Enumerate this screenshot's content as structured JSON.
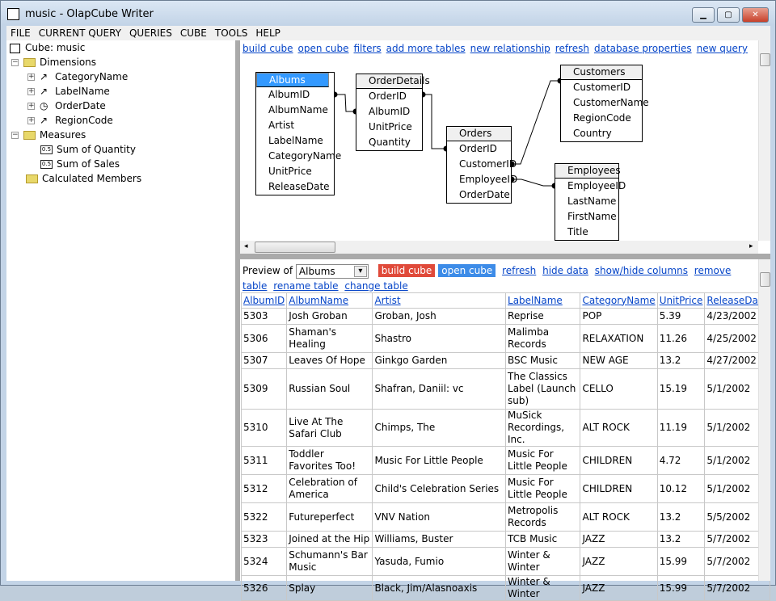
{
  "window": {
    "title": "music - OlapCube Writer",
    "min": "▁",
    "max": "▢",
    "close": "✕"
  },
  "menu": [
    "FILE",
    "CURRENT QUERY",
    "QUERIES",
    "CUBE",
    "TOOLS",
    "HELP"
  ],
  "tree": {
    "cube": "Cube: music",
    "dimensions": "Dimensions",
    "dims": [
      {
        "label": "CategoryName",
        "icon": "hierarchy-icon"
      },
      {
        "label": "LabelName",
        "icon": "hierarchy-icon"
      },
      {
        "label": "OrderDate",
        "icon": "clock-icon"
      },
      {
        "label": "RegionCode",
        "icon": "hierarchy-icon"
      }
    ],
    "measures": "Measures",
    "meas": [
      "Sum of Quantity",
      "Sum of Sales"
    ],
    "calculated": "Calculated Members"
  },
  "diagram_links": [
    "build cube",
    "open cube",
    "filters",
    "add more tables",
    "new relationship",
    "refresh",
    "database properties",
    "new query"
  ],
  "tables": [
    {
      "name": "Albums",
      "selected": true,
      "fields": [
        "AlbumID",
        "AlbumName",
        "Artist",
        "LabelName",
        "CategoryName",
        "UnitPrice",
        "ReleaseDate"
      ]
    },
    {
      "name": "OrderDetails",
      "fields": [
        "OrderID",
        "AlbumID",
        "UnitPrice",
        "Quantity"
      ]
    },
    {
      "name": "Orders",
      "fields": [
        "OrderID",
        "CustomerID",
        "EmployeeID",
        "OrderDate"
      ]
    },
    {
      "name": "Customers",
      "fields": [
        "CustomerID",
        "CustomerName",
        "RegionCode",
        "Country"
      ]
    },
    {
      "name": "Employees",
      "fields": [
        "EmployeeID",
        "LastName",
        "FirstName",
        "Title"
      ]
    }
  ],
  "preview": {
    "label": "Preview of",
    "selected": "Albums",
    "build": "build cube",
    "open": "open cube",
    "links": [
      "refresh",
      "hide data",
      "show/hide columns",
      "remove table",
      "rename table",
      "change table"
    ]
  },
  "grid": {
    "columns": [
      "AlbumID",
      "AlbumName",
      "Artist",
      "LabelName",
      "CategoryName",
      "UnitPrice",
      "ReleaseDate"
    ],
    "rows": [
      [
        "5303",
        "Josh Groban",
        "Groban, Josh",
        "Reprise",
        "POP",
        "5.39",
        "4/23/2002"
      ],
      [
        "5306",
        "Shaman's Healing",
        "Shastro",
        "Malimba Records",
        "RELAXATION",
        "11.26",
        "4/25/2002"
      ],
      [
        "5307",
        "Leaves Of Hope",
        "Ginkgo Garden",
        "BSC Music",
        "NEW AGE",
        "13.2",
        "4/27/2002"
      ],
      [
        "5309",
        "Russian Soul",
        "Shafran, Daniil: vc",
        "The Classics Label (Launch sub)",
        "CELLO",
        "15.19",
        "5/1/2002"
      ],
      [
        "5310",
        "Live At The Safari Club",
        "Chimps, The",
        "MuSick Recordings, Inc.",
        "ALT ROCK",
        "11.19",
        "5/1/2002"
      ],
      [
        "5311",
        "Toddler Favorites Too!",
        "Music For Little People",
        "Music For Little People",
        "CHILDREN",
        "4.72",
        "5/1/2002"
      ],
      [
        "5312",
        "Celebration of America",
        "Child's Celebration Series",
        "Music For Little People",
        "CHILDREN",
        "10.12",
        "5/1/2002"
      ],
      [
        "5322",
        "Futureperfect",
        "VNV Nation",
        "Metropolis Records",
        "ALT ROCK",
        "13.2",
        "5/5/2002"
      ],
      [
        "5323",
        "Joined at the Hip",
        "Williams, Buster",
        "TCB Music",
        "JAZZ",
        "13.2",
        "5/7/2002"
      ],
      [
        "5324",
        "Schumann's Bar Music",
        "Yasuda, Fumio",
        "Winter & Winter",
        "JAZZ",
        "15.99",
        "5/7/2002"
      ],
      [
        "5326",
        "Splay",
        "Black, Jim/Alasnoaxis",
        "Winter & Winter",
        "JAZZ",
        "15.99",
        "5/7/2002"
      ]
    ]
  }
}
